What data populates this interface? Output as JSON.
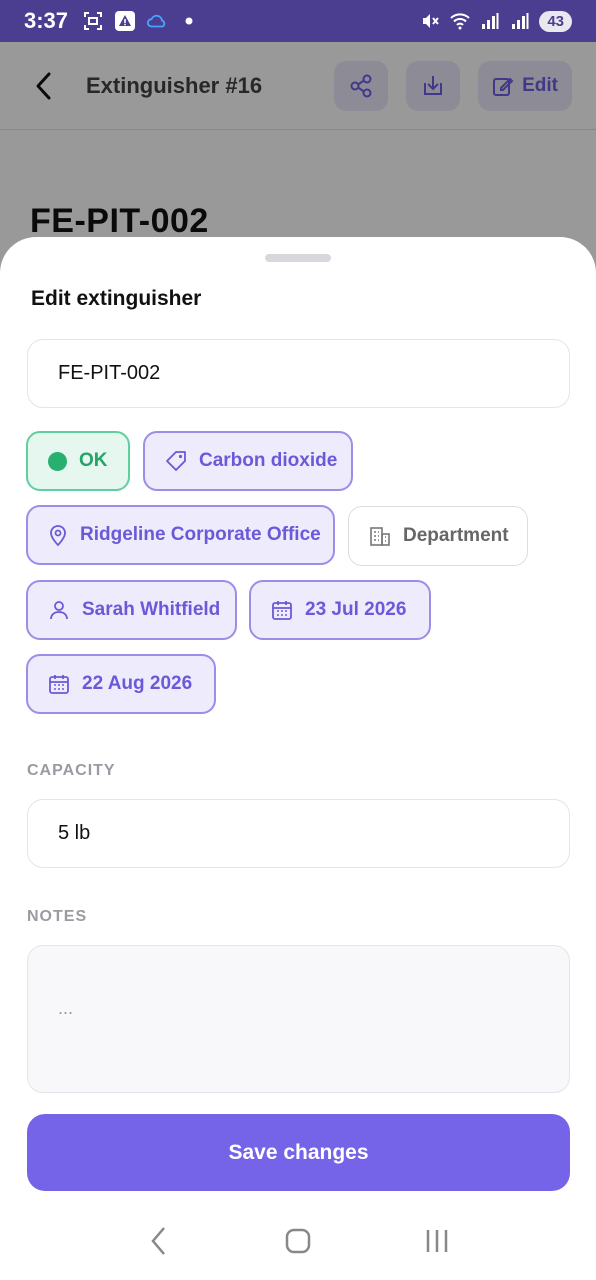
{
  "status_bar": {
    "time": "3:37",
    "battery": "43",
    "icons_left": [
      "screenshot-icon",
      "alert-icon",
      "cloud-icon",
      "dot-icon"
    ],
    "icons_right": [
      "mute-icon",
      "wifi-icon",
      "signal-icon",
      "signal-icon"
    ]
  },
  "background_page": {
    "title": "Extinguisher #16",
    "edit_label": "Edit",
    "code": "FE-PIT-002"
  },
  "sheet": {
    "title": "Edit extinguisher",
    "name_value": "FE-PIT-002",
    "chips": {
      "status": "OK",
      "type": "Carbon dioxide",
      "location": "Ridgeline Corporate Office",
      "department": "Department",
      "person": "Sarah Whitfield",
      "date1": "23 Jul 2026",
      "date2": "22 Aug 2026"
    },
    "capacity_label": "CAPACITY",
    "capacity_value": "5 lb",
    "notes_label": "NOTES",
    "notes_placeholder": "...",
    "save_label": "Save changes"
  },
  "colors": {
    "accent": "#7664e8",
    "ok_green": "#27b06f",
    "status_bar": "#4b3d90"
  }
}
